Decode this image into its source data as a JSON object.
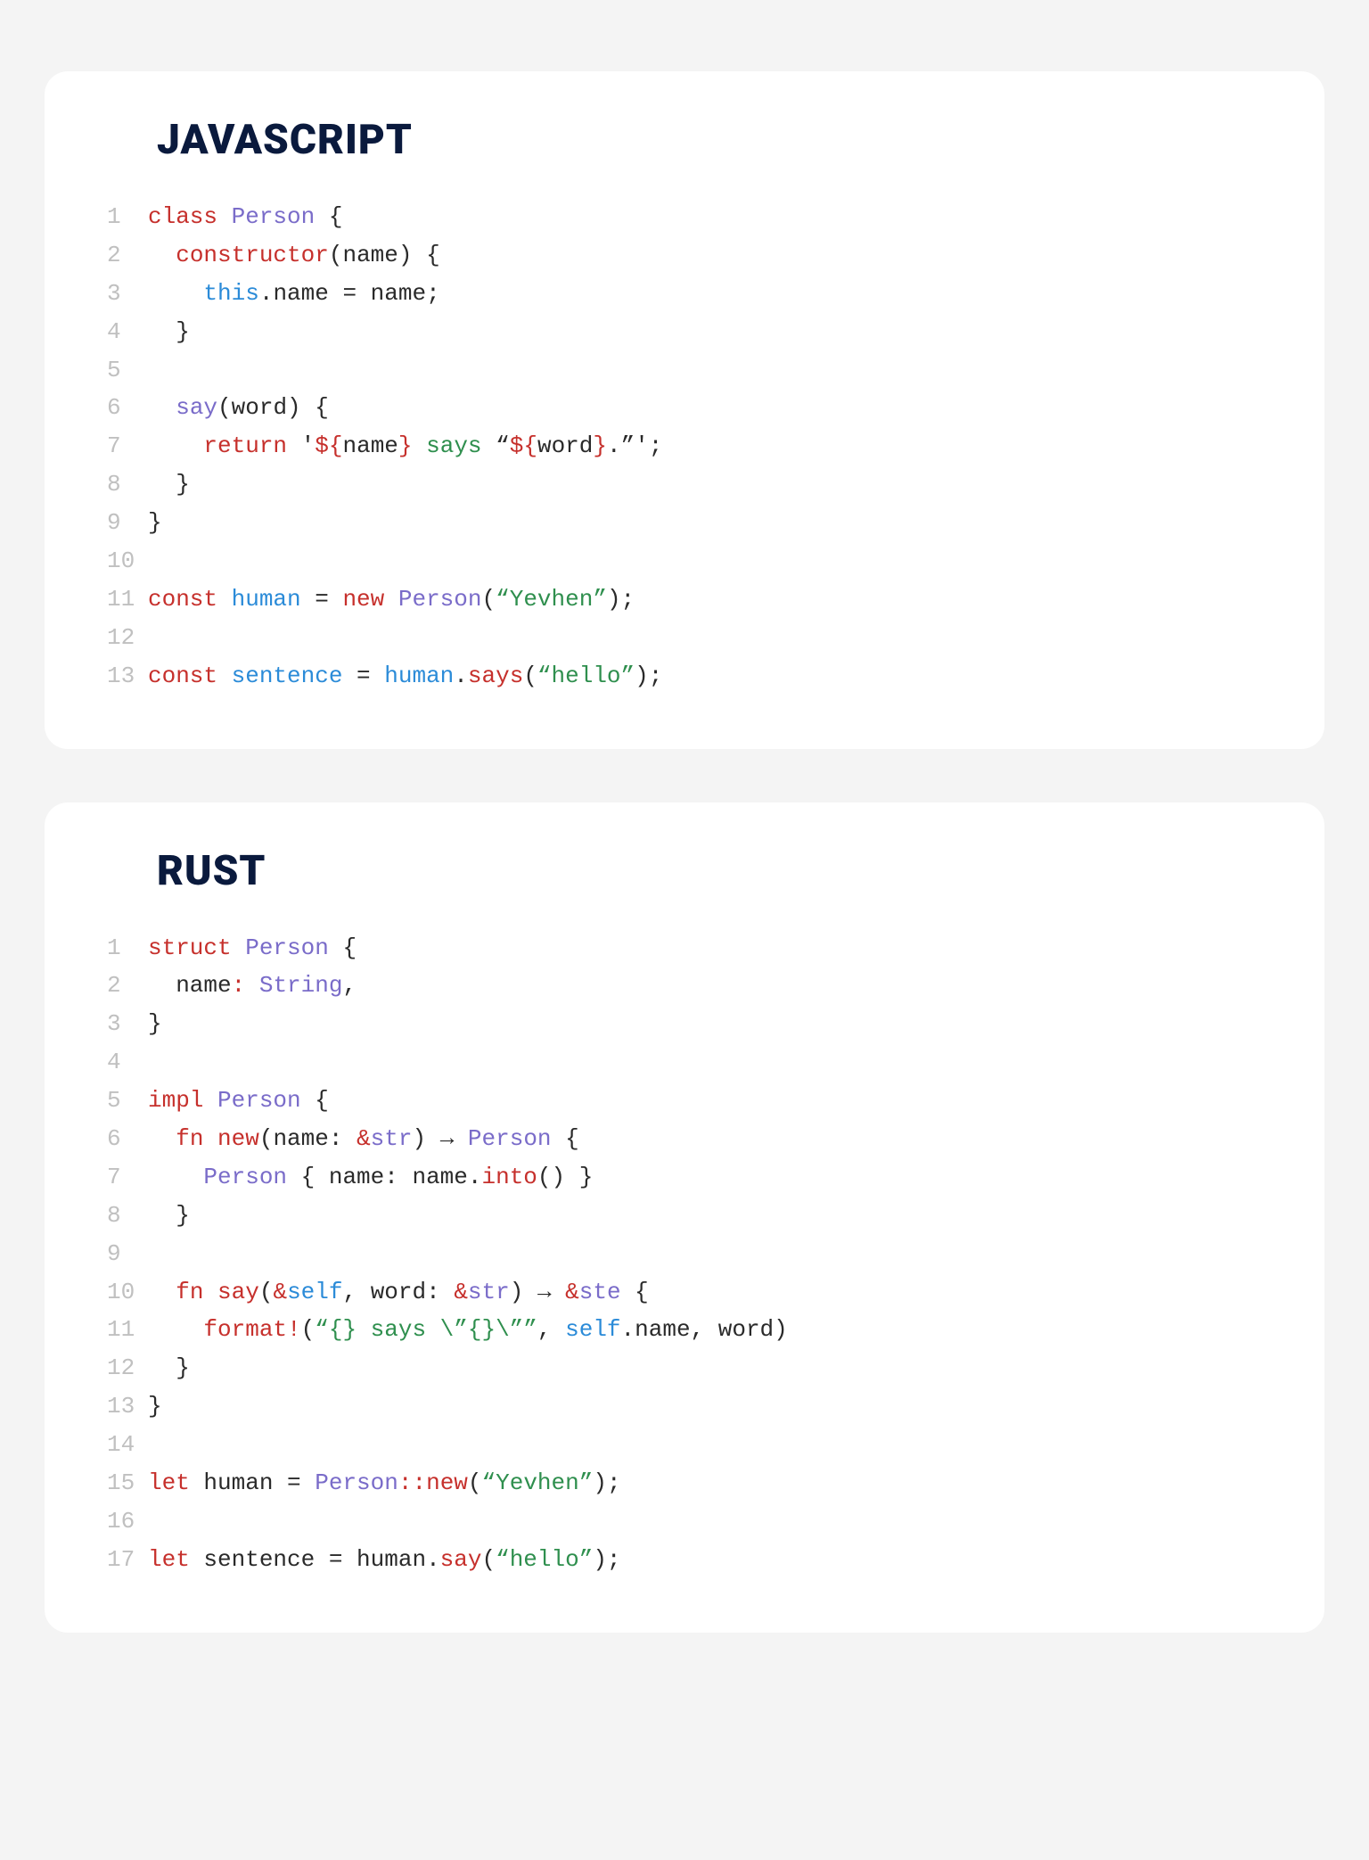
{
  "cards": [
    {
      "title": "JAVASCRIPT",
      "lines": [
        {
          "n": "1",
          "t": [
            [
              "kw",
              "class "
            ],
            [
              "cls",
              "Person"
            ],
            [
              "txt",
              " {"
            ]
          ]
        },
        {
          "n": "2",
          "t": [
            [
              "txt",
              "  "
            ],
            [
              "mth",
              "constructor"
            ],
            [
              "txt",
              "(name) {"
            ]
          ]
        },
        {
          "n": "3",
          "t": [
            [
              "txt",
              "    "
            ],
            [
              "id",
              "this"
            ],
            [
              "txt",
              ".name = name;"
            ]
          ]
        },
        {
          "n": "4",
          "t": [
            [
              "txt",
              "  }"
            ]
          ]
        },
        {
          "n": "5",
          "t": [
            [
              "txt",
              ""
            ]
          ]
        },
        {
          "n": "6",
          "t": [
            [
              "txt",
              "  "
            ],
            [
              "fn",
              "say"
            ],
            [
              "txt",
              "(word) {"
            ]
          ]
        },
        {
          "n": "7",
          "t": [
            [
              "txt",
              "    "
            ],
            [
              "kw",
              "return"
            ],
            [
              "txt",
              " '"
            ],
            [
              "mth",
              "${"
            ],
            [
              "txt",
              "name"
            ],
            [
              "mth",
              "}"
            ],
            [
              "str",
              " says "
            ],
            [
              "txt",
              "“"
            ],
            [
              "mth",
              "${"
            ],
            [
              "txt",
              "word"
            ],
            [
              "mth",
              "}"
            ],
            [
              "txt",
              ".”';"
            ]
          ]
        },
        {
          "n": "8",
          "t": [
            [
              "txt",
              "  }"
            ]
          ]
        },
        {
          "n": "9",
          "t": [
            [
              "txt",
              "}"
            ]
          ]
        },
        {
          "n": "10",
          "t": [
            [
              "txt",
              ""
            ]
          ]
        },
        {
          "n": "11",
          "t": [
            [
              "kw",
              "const "
            ],
            [
              "id",
              "human"
            ],
            [
              "txt",
              " = "
            ],
            [
              "kw",
              "new "
            ],
            [
              "cls",
              "Person"
            ],
            [
              "txt",
              "("
            ],
            [
              "str",
              "“Yevhen”"
            ],
            [
              "txt",
              ");"
            ]
          ]
        },
        {
          "n": "12",
          "t": [
            [
              "txt",
              ""
            ]
          ]
        },
        {
          "n": "13",
          "t": [
            [
              "kw",
              "const "
            ],
            [
              "id",
              "sentence"
            ],
            [
              "txt",
              " = "
            ],
            [
              "id",
              "human"
            ],
            [
              "txt",
              "."
            ],
            [
              "mth",
              "says"
            ],
            [
              "txt",
              "("
            ],
            [
              "str",
              "“hello”"
            ],
            [
              "txt",
              ");"
            ]
          ]
        }
      ]
    },
    {
      "title": "RUST",
      "lines": [
        {
          "n": "1",
          "t": [
            [
              "kw",
              "struct "
            ],
            [
              "cls",
              "Person"
            ],
            [
              "txt",
              " {"
            ]
          ]
        },
        {
          "n": "2",
          "t": [
            [
              "txt",
              "  name"
            ],
            [
              "kw",
              ": "
            ],
            [
              "cls",
              "String"
            ],
            [
              "txt",
              ","
            ]
          ]
        },
        {
          "n": "3",
          "t": [
            [
              "txt",
              "}"
            ]
          ]
        },
        {
          "n": "4",
          "t": [
            [
              "txt",
              ""
            ]
          ]
        },
        {
          "n": "5",
          "t": [
            [
              "kw",
              "impl "
            ],
            [
              "cls",
              "Person"
            ],
            [
              "txt",
              " {"
            ]
          ]
        },
        {
          "n": "6",
          "t": [
            [
              "txt",
              "  "
            ],
            [
              "kw",
              "fn "
            ],
            [
              "mth",
              "new"
            ],
            [
              "txt",
              "(name: "
            ],
            [
              "kw",
              "&"
            ],
            [
              "cls",
              "str"
            ],
            [
              "txt",
              ") → "
            ],
            [
              "cls",
              "Person"
            ],
            [
              "txt",
              " {"
            ]
          ]
        },
        {
          "n": "7",
          "t": [
            [
              "txt",
              "    "
            ],
            [
              "cls",
              "Person"
            ],
            [
              "txt",
              " { name: name."
            ],
            [
              "mth",
              "into"
            ],
            [
              "txt",
              "() }"
            ]
          ]
        },
        {
          "n": "8",
          "t": [
            [
              "txt",
              "  }"
            ]
          ]
        },
        {
          "n": "9",
          "t": [
            [
              "txt",
              ""
            ]
          ]
        },
        {
          "n": "10",
          "t": [
            [
              "txt",
              "  "
            ],
            [
              "kw",
              "fn "
            ],
            [
              "mth",
              "say"
            ],
            [
              "txt",
              "("
            ],
            [
              "kw",
              "&"
            ],
            [
              "id",
              "self"
            ],
            [
              "txt",
              ", word: "
            ],
            [
              "kw",
              "&"
            ],
            [
              "cls",
              "str"
            ],
            [
              "txt",
              ") → "
            ],
            [
              "kw",
              "&"
            ],
            [
              "cls",
              "ste"
            ],
            [
              "txt",
              " {"
            ]
          ]
        },
        {
          "n": "11",
          "t": [
            [
              "txt",
              "    "
            ],
            [
              "mth",
              "format!"
            ],
            [
              "txt",
              "("
            ],
            [
              "str",
              "“{} says \\”{}\\””"
            ],
            [
              "txt",
              ", "
            ],
            [
              "id",
              "self"
            ],
            [
              "txt",
              ".name, word)"
            ]
          ]
        },
        {
          "n": "12",
          "t": [
            [
              "txt",
              "  }"
            ]
          ]
        },
        {
          "n": "13",
          "t": [
            [
              "txt",
              "}"
            ]
          ]
        },
        {
          "n": "14",
          "t": [
            [
              "txt",
              ""
            ]
          ]
        },
        {
          "n": "15",
          "t": [
            [
              "kw",
              "let "
            ],
            [
              "txt",
              "human = "
            ],
            [
              "cls",
              "Person"
            ],
            [
              "kw",
              "::"
            ],
            [
              "mth",
              "new"
            ],
            [
              "txt",
              "("
            ],
            [
              "str",
              "“Yevhen”"
            ],
            [
              "txt",
              ");"
            ]
          ]
        },
        {
          "n": "16",
          "t": [
            [
              "txt",
              ""
            ]
          ]
        },
        {
          "n": "17",
          "t": [
            [
              "kw",
              "let "
            ],
            [
              "txt",
              "sentence = human."
            ],
            [
              "mth",
              "say"
            ],
            [
              "txt",
              "("
            ],
            [
              "str",
              "“hello”"
            ],
            [
              "txt",
              ");"
            ]
          ]
        }
      ]
    }
  ]
}
